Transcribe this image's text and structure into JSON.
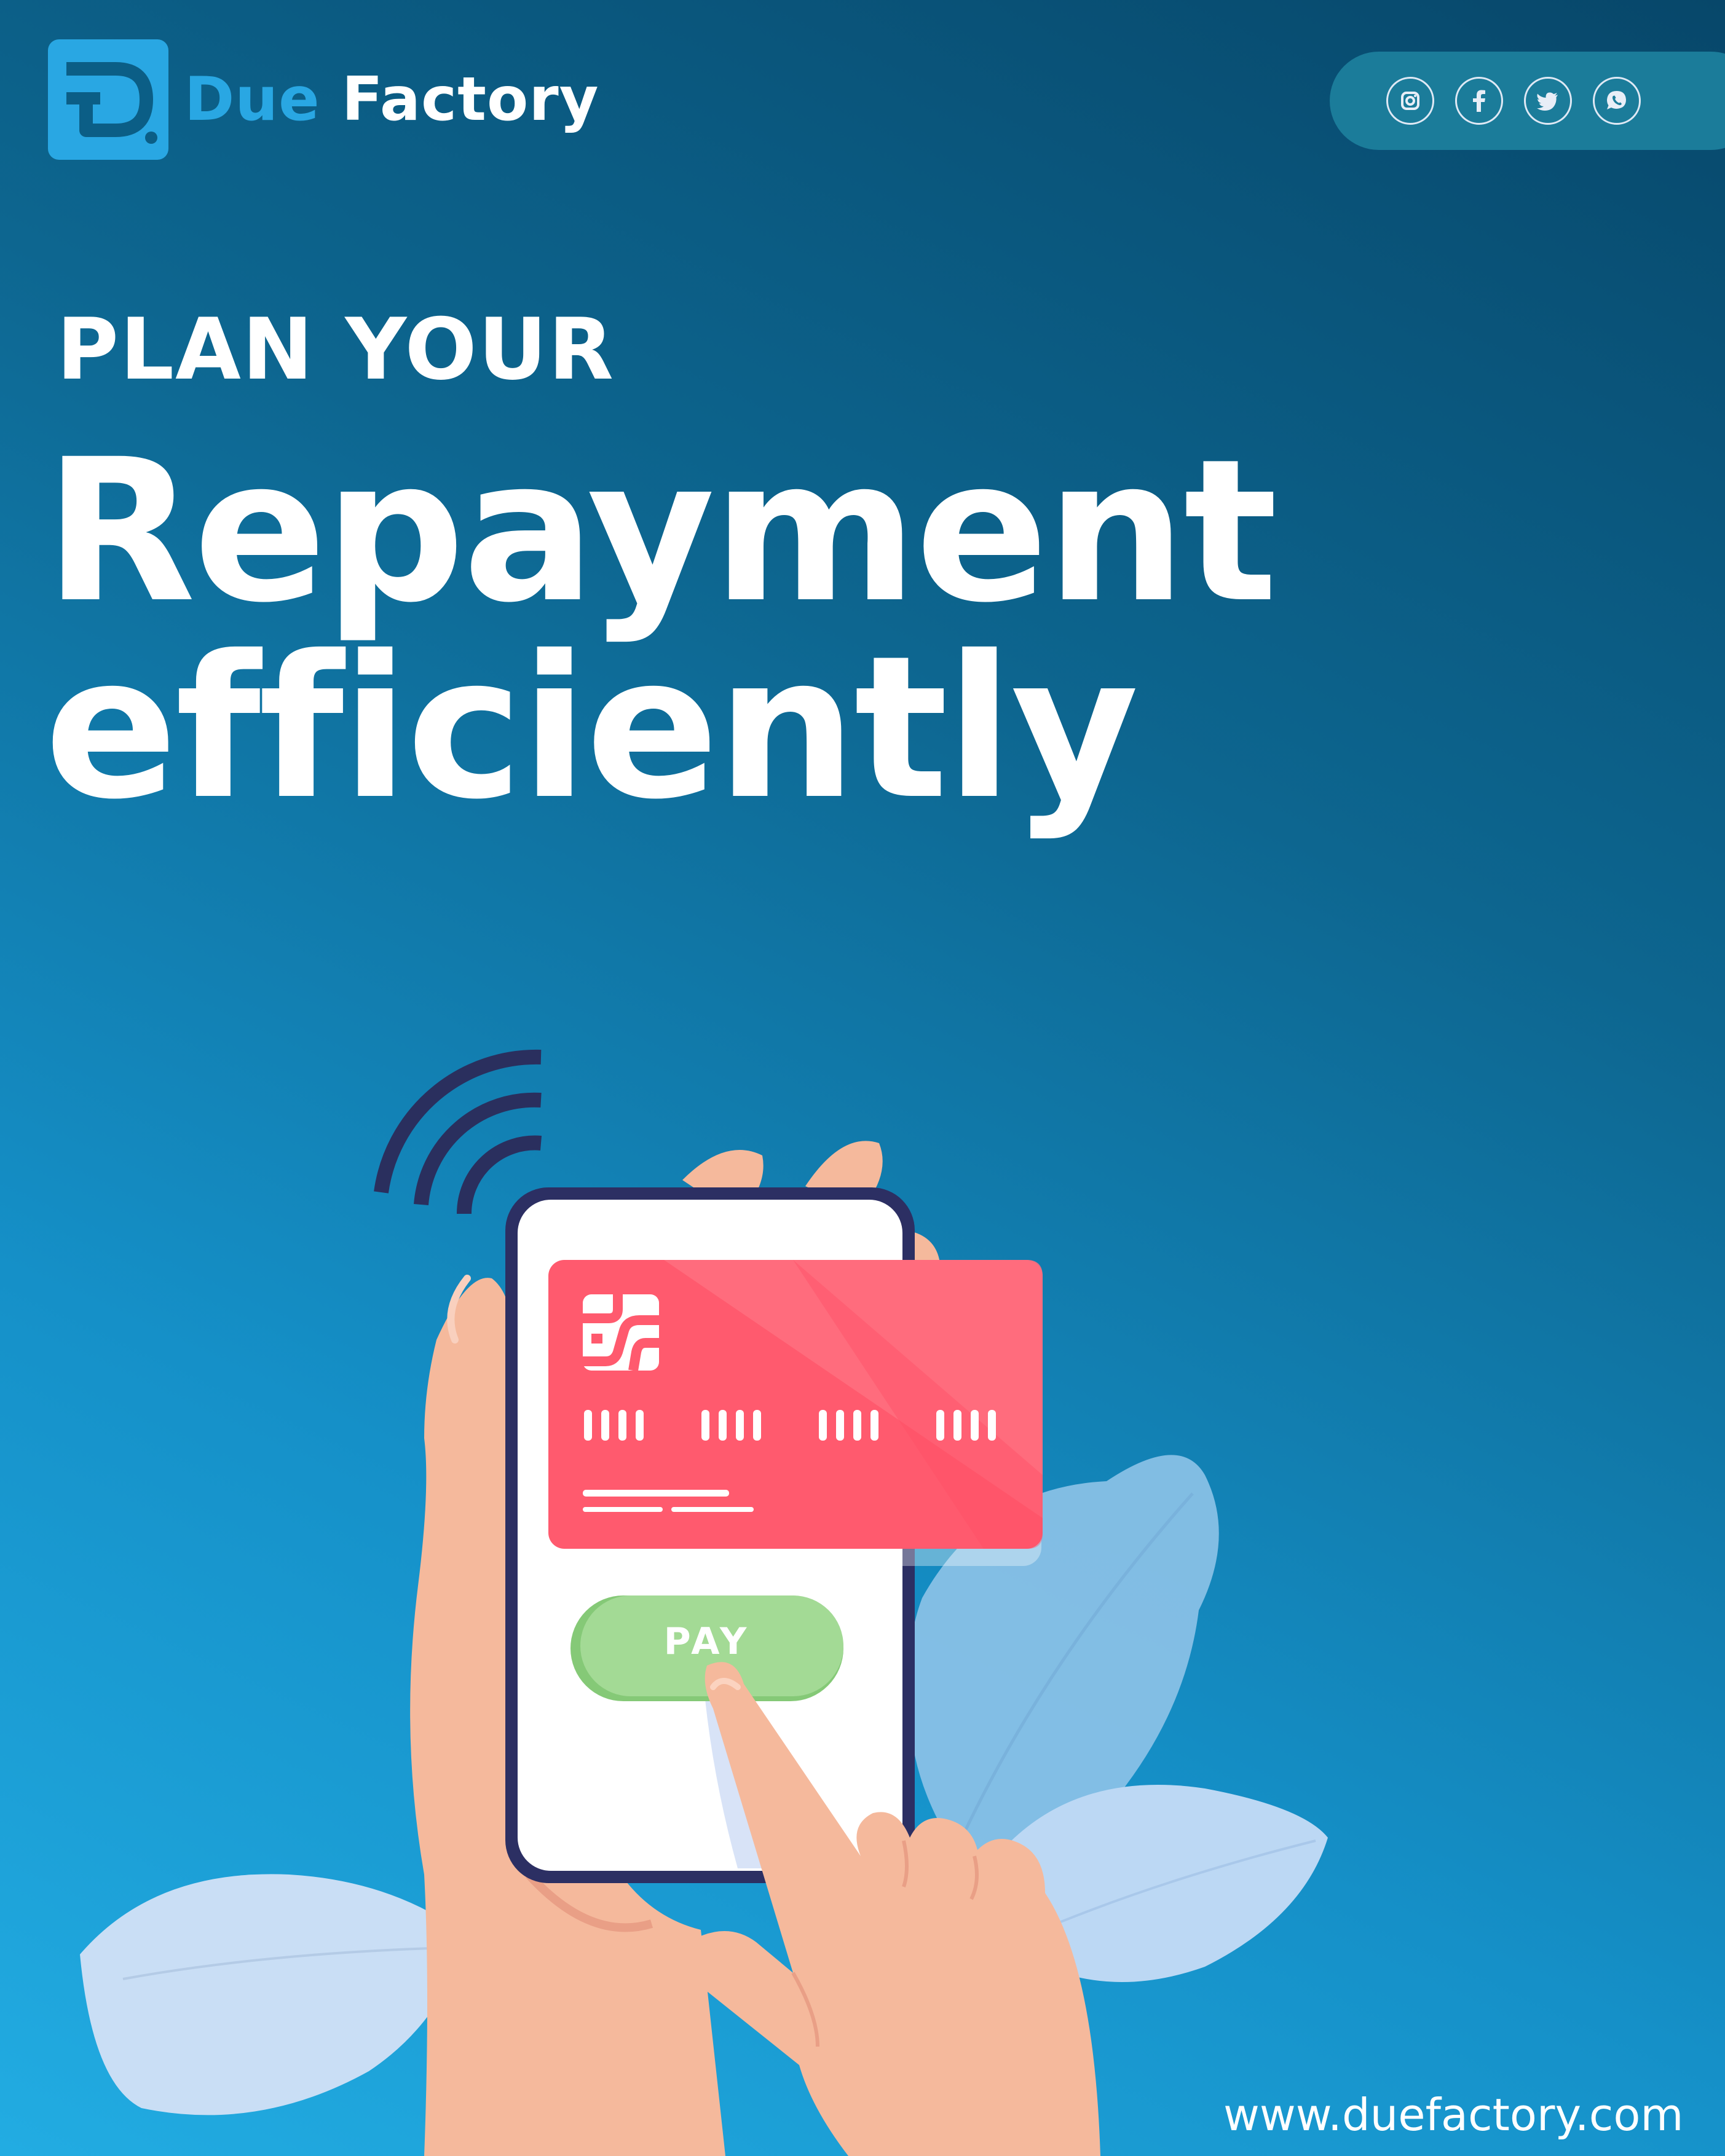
{
  "brand": {
    "name_part1": "Due",
    "name_part2": "Factory",
    "logo_icon": "d-letter-logo-icon",
    "colors": {
      "brand_blue": "#29a7e3",
      "background_dark": "#07476a",
      "background_light": "#22ace2"
    }
  },
  "social": {
    "icons": [
      "instagram-icon",
      "facebook-icon",
      "twitter-icon",
      "whatsapp-icon"
    ]
  },
  "headline": {
    "line1": "PLAN YOUR",
    "line2": "Repayment",
    "line3": "efficiently"
  },
  "illustration": {
    "button_label": "PAY",
    "card_color": "#ff5a6e",
    "button_color": "#9fd98f",
    "icons": [
      "nfc-signal-icon",
      "card-chip-icon"
    ]
  },
  "footer": {
    "website": "www.duefactory.com"
  }
}
